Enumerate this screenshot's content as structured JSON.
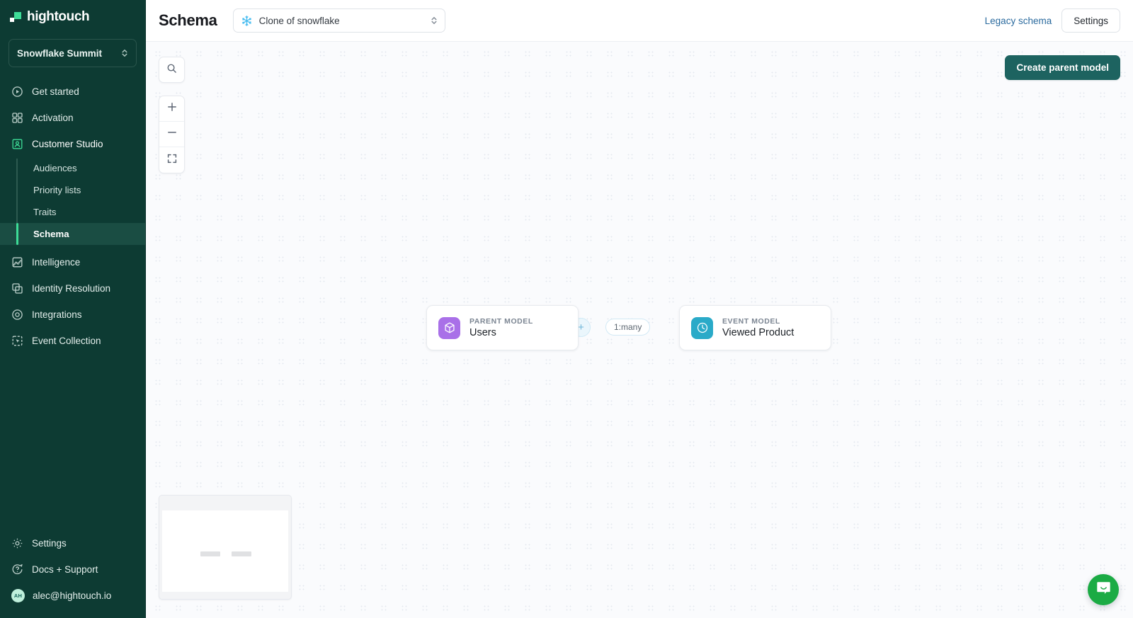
{
  "brand": {
    "name": "hightouch",
    "logo_icon": "hightouch-logo-icon"
  },
  "workspace": {
    "name": "Snowflake Summit",
    "selector_icon": "chevron-up-down-icon"
  },
  "sidebar": {
    "items": [
      {
        "label": "Get started",
        "icon": "play-circle-icon"
      },
      {
        "label": "Activation",
        "icon": "grid-squares-icon"
      },
      {
        "label": "Customer Studio",
        "icon": "customer-studio-icon",
        "active": true
      }
    ],
    "sub_items": [
      {
        "label": "Audiences",
        "selected": false
      },
      {
        "label": "Priority lists",
        "selected": false
      },
      {
        "label": "Traits",
        "selected": false
      },
      {
        "label": "Schema",
        "selected": true
      }
    ],
    "items_lower": [
      {
        "label": "Intelligence",
        "icon": "chart-area-icon"
      },
      {
        "label": "Identity Resolution",
        "icon": "overlapping-squares-icon"
      },
      {
        "label": "Integrations",
        "icon": "integrations-orbit-icon"
      },
      {
        "label": "Event Collection",
        "icon": "cursor-box-icon"
      }
    ],
    "bottom": [
      {
        "label": "Settings",
        "icon": "gear-icon"
      },
      {
        "label": "Docs + Support",
        "icon": "question-circle-icon"
      }
    ],
    "user": {
      "email": "alec@hightouch.io",
      "initials": "AH",
      "avatar_bg": "#bff0dc"
    }
  },
  "header": {
    "title": "Schema",
    "source": {
      "name": "Clone of snowflake",
      "icon": "snowflake-icon",
      "caret_icon": "chevron-up-down-icon"
    },
    "legacy_link": "Legacy schema",
    "settings_button": "Settings"
  },
  "canvas": {
    "controls": [
      {
        "name": "search",
        "icon": "search-icon"
      },
      {
        "name": "zoom-in",
        "icon": "plus-icon"
      },
      {
        "name": "zoom-out",
        "icon": "minus-icon"
      },
      {
        "name": "fit-view",
        "icon": "fit-screen-icon"
      }
    ],
    "create_button": "Create parent model",
    "nodes": [
      {
        "kind": "PARENT MODEL",
        "label": "Users",
        "icon": "cube-icon",
        "color": "#a970e8"
      },
      {
        "kind": "EVENT MODEL",
        "label": "Viewed Product",
        "icon": "clock-icon",
        "color": "#2aaac8"
      }
    ],
    "edge": {
      "label": "1:many",
      "add_icon": "plus-icon"
    },
    "minimap": {
      "node_count": 2
    }
  },
  "chat": {
    "icon": "chat-bubble-icon",
    "color": "#1bab44"
  },
  "colors": {
    "sidebar_bg": "#0d3b33",
    "accent_green": "#3ddc97",
    "primary_button": "#1d6360",
    "link_blue": "#2a6a9e"
  }
}
